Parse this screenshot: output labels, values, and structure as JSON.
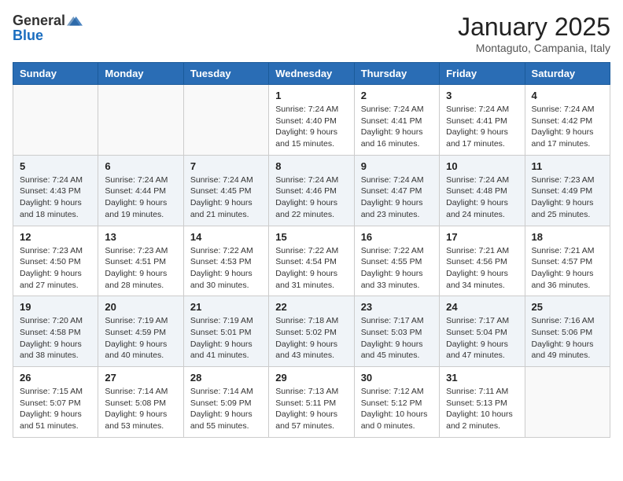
{
  "header": {
    "logo": {
      "text_general": "General",
      "text_blue": "Blue"
    },
    "title": "January 2025",
    "subtitle": "Montaguto, Campania, Italy"
  },
  "weekdays": [
    "Sunday",
    "Monday",
    "Tuesday",
    "Wednesday",
    "Thursday",
    "Friday",
    "Saturday"
  ],
  "weeks": [
    [
      {
        "day": "",
        "info": ""
      },
      {
        "day": "",
        "info": ""
      },
      {
        "day": "",
        "info": ""
      },
      {
        "day": "1",
        "info": "Sunrise: 7:24 AM\nSunset: 4:40 PM\nDaylight: 9 hours\nand 15 minutes."
      },
      {
        "day": "2",
        "info": "Sunrise: 7:24 AM\nSunset: 4:41 PM\nDaylight: 9 hours\nand 16 minutes."
      },
      {
        "day": "3",
        "info": "Sunrise: 7:24 AM\nSunset: 4:41 PM\nDaylight: 9 hours\nand 17 minutes."
      },
      {
        "day": "4",
        "info": "Sunrise: 7:24 AM\nSunset: 4:42 PM\nDaylight: 9 hours\nand 17 minutes."
      }
    ],
    [
      {
        "day": "5",
        "info": "Sunrise: 7:24 AM\nSunset: 4:43 PM\nDaylight: 9 hours\nand 18 minutes."
      },
      {
        "day": "6",
        "info": "Sunrise: 7:24 AM\nSunset: 4:44 PM\nDaylight: 9 hours\nand 19 minutes."
      },
      {
        "day": "7",
        "info": "Sunrise: 7:24 AM\nSunset: 4:45 PM\nDaylight: 9 hours\nand 21 minutes."
      },
      {
        "day": "8",
        "info": "Sunrise: 7:24 AM\nSunset: 4:46 PM\nDaylight: 9 hours\nand 22 minutes."
      },
      {
        "day": "9",
        "info": "Sunrise: 7:24 AM\nSunset: 4:47 PM\nDaylight: 9 hours\nand 23 minutes."
      },
      {
        "day": "10",
        "info": "Sunrise: 7:24 AM\nSunset: 4:48 PM\nDaylight: 9 hours\nand 24 minutes."
      },
      {
        "day": "11",
        "info": "Sunrise: 7:23 AM\nSunset: 4:49 PM\nDaylight: 9 hours\nand 25 minutes."
      }
    ],
    [
      {
        "day": "12",
        "info": "Sunrise: 7:23 AM\nSunset: 4:50 PM\nDaylight: 9 hours\nand 27 minutes."
      },
      {
        "day": "13",
        "info": "Sunrise: 7:23 AM\nSunset: 4:51 PM\nDaylight: 9 hours\nand 28 minutes."
      },
      {
        "day": "14",
        "info": "Sunrise: 7:22 AM\nSunset: 4:53 PM\nDaylight: 9 hours\nand 30 minutes."
      },
      {
        "day": "15",
        "info": "Sunrise: 7:22 AM\nSunset: 4:54 PM\nDaylight: 9 hours\nand 31 minutes."
      },
      {
        "day": "16",
        "info": "Sunrise: 7:22 AM\nSunset: 4:55 PM\nDaylight: 9 hours\nand 33 minutes."
      },
      {
        "day": "17",
        "info": "Sunrise: 7:21 AM\nSunset: 4:56 PM\nDaylight: 9 hours\nand 34 minutes."
      },
      {
        "day": "18",
        "info": "Sunrise: 7:21 AM\nSunset: 4:57 PM\nDaylight: 9 hours\nand 36 minutes."
      }
    ],
    [
      {
        "day": "19",
        "info": "Sunrise: 7:20 AM\nSunset: 4:58 PM\nDaylight: 9 hours\nand 38 minutes."
      },
      {
        "day": "20",
        "info": "Sunrise: 7:19 AM\nSunset: 4:59 PM\nDaylight: 9 hours\nand 40 minutes."
      },
      {
        "day": "21",
        "info": "Sunrise: 7:19 AM\nSunset: 5:01 PM\nDaylight: 9 hours\nand 41 minutes."
      },
      {
        "day": "22",
        "info": "Sunrise: 7:18 AM\nSunset: 5:02 PM\nDaylight: 9 hours\nand 43 minutes."
      },
      {
        "day": "23",
        "info": "Sunrise: 7:17 AM\nSunset: 5:03 PM\nDaylight: 9 hours\nand 45 minutes."
      },
      {
        "day": "24",
        "info": "Sunrise: 7:17 AM\nSunset: 5:04 PM\nDaylight: 9 hours\nand 47 minutes."
      },
      {
        "day": "25",
        "info": "Sunrise: 7:16 AM\nSunset: 5:06 PM\nDaylight: 9 hours\nand 49 minutes."
      }
    ],
    [
      {
        "day": "26",
        "info": "Sunrise: 7:15 AM\nSunset: 5:07 PM\nDaylight: 9 hours\nand 51 minutes."
      },
      {
        "day": "27",
        "info": "Sunrise: 7:14 AM\nSunset: 5:08 PM\nDaylight: 9 hours\nand 53 minutes."
      },
      {
        "day": "28",
        "info": "Sunrise: 7:14 AM\nSunset: 5:09 PM\nDaylight: 9 hours\nand 55 minutes."
      },
      {
        "day": "29",
        "info": "Sunrise: 7:13 AM\nSunset: 5:11 PM\nDaylight: 9 hours\nand 57 minutes."
      },
      {
        "day": "30",
        "info": "Sunrise: 7:12 AM\nSunset: 5:12 PM\nDaylight: 10 hours\nand 0 minutes."
      },
      {
        "day": "31",
        "info": "Sunrise: 7:11 AM\nSunset: 5:13 PM\nDaylight: 10 hours\nand 2 minutes."
      },
      {
        "day": "",
        "info": ""
      }
    ]
  ]
}
